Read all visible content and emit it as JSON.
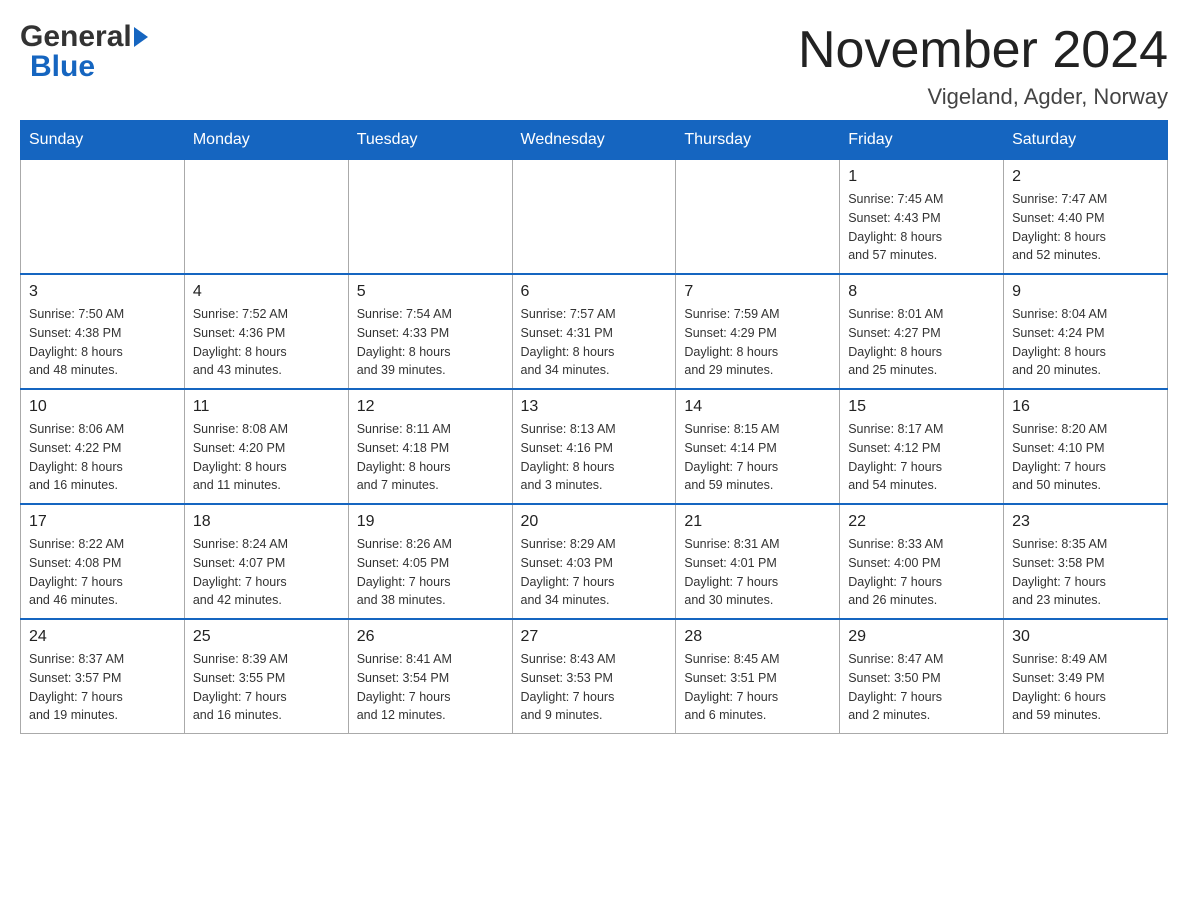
{
  "header": {
    "month_title": "November 2024",
    "location": "Vigeland, Agder, Norway"
  },
  "weekdays": [
    "Sunday",
    "Monday",
    "Tuesday",
    "Wednesday",
    "Thursday",
    "Friday",
    "Saturday"
  ],
  "weeks": [
    [
      {
        "day": "",
        "info": ""
      },
      {
        "day": "",
        "info": ""
      },
      {
        "day": "",
        "info": ""
      },
      {
        "day": "",
        "info": ""
      },
      {
        "day": "",
        "info": ""
      },
      {
        "day": "1",
        "info": "Sunrise: 7:45 AM\nSunset: 4:43 PM\nDaylight: 8 hours\nand 57 minutes."
      },
      {
        "day": "2",
        "info": "Sunrise: 7:47 AM\nSunset: 4:40 PM\nDaylight: 8 hours\nand 52 minutes."
      }
    ],
    [
      {
        "day": "3",
        "info": "Sunrise: 7:50 AM\nSunset: 4:38 PM\nDaylight: 8 hours\nand 48 minutes."
      },
      {
        "day": "4",
        "info": "Sunrise: 7:52 AM\nSunset: 4:36 PM\nDaylight: 8 hours\nand 43 minutes."
      },
      {
        "day": "5",
        "info": "Sunrise: 7:54 AM\nSunset: 4:33 PM\nDaylight: 8 hours\nand 39 minutes."
      },
      {
        "day": "6",
        "info": "Sunrise: 7:57 AM\nSunset: 4:31 PM\nDaylight: 8 hours\nand 34 minutes."
      },
      {
        "day": "7",
        "info": "Sunrise: 7:59 AM\nSunset: 4:29 PM\nDaylight: 8 hours\nand 29 minutes."
      },
      {
        "day": "8",
        "info": "Sunrise: 8:01 AM\nSunset: 4:27 PM\nDaylight: 8 hours\nand 25 minutes."
      },
      {
        "day": "9",
        "info": "Sunrise: 8:04 AM\nSunset: 4:24 PM\nDaylight: 8 hours\nand 20 minutes."
      }
    ],
    [
      {
        "day": "10",
        "info": "Sunrise: 8:06 AM\nSunset: 4:22 PM\nDaylight: 8 hours\nand 16 minutes."
      },
      {
        "day": "11",
        "info": "Sunrise: 8:08 AM\nSunset: 4:20 PM\nDaylight: 8 hours\nand 11 minutes."
      },
      {
        "day": "12",
        "info": "Sunrise: 8:11 AM\nSunset: 4:18 PM\nDaylight: 8 hours\nand 7 minutes."
      },
      {
        "day": "13",
        "info": "Sunrise: 8:13 AM\nSunset: 4:16 PM\nDaylight: 8 hours\nand 3 minutes."
      },
      {
        "day": "14",
        "info": "Sunrise: 8:15 AM\nSunset: 4:14 PM\nDaylight: 7 hours\nand 59 minutes."
      },
      {
        "day": "15",
        "info": "Sunrise: 8:17 AM\nSunset: 4:12 PM\nDaylight: 7 hours\nand 54 minutes."
      },
      {
        "day": "16",
        "info": "Sunrise: 8:20 AM\nSunset: 4:10 PM\nDaylight: 7 hours\nand 50 minutes."
      }
    ],
    [
      {
        "day": "17",
        "info": "Sunrise: 8:22 AM\nSunset: 4:08 PM\nDaylight: 7 hours\nand 46 minutes."
      },
      {
        "day": "18",
        "info": "Sunrise: 8:24 AM\nSunset: 4:07 PM\nDaylight: 7 hours\nand 42 minutes."
      },
      {
        "day": "19",
        "info": "Sunrise: 8:26 AM\nSunset: 4:05 PM\nDaylight: 7 hours\nand 38 minutes."
      },
      {
        "day": "20",
        "info": "Sunrise: 8:29 AM\nSunset: 4:03 PM\nDaylight: 7 hours\nand 34 minutes."
      },
      {
        "day": "21",
        "info": "Sunrise: 8:31 AM\nSunset: 4:01 PM\nDaylight: 7 hours\nand 30 minutes."
      },
      {
        "day": "22",
        "info": "Sunrise: 8:33 AM\nSunset: 4:00 PM\nDaylight: 7 hours\nand 26 minutes."
      },
      {
        "day": "23",
        "info": "Sunrise: 8:35 AM\nSunset: 3:58 PM\nDaylight: 7 hours\nand 23 minutes."
      }
    ],
    [
      {
        "day": "24",
        "info": "Sunrise: 8:37 AM\nSunset: 3:57 PM\nDaylight: 7 hours\nand 19 minutes."
      },
      {
        "day": "25",
        "info": "Sunrise: 8:39 AM\nSunset: 3:55 PM\nDaylight: 7 hours\nand 16 minutes."
      },
      {
        "day": "26",
        "info": "Sunrise: 8:41 AM\nSunset: 3:54 PM\nDaylight: 7 hours\nand 12 minutes."
      },
      {
        "day": "27",
        "info": "Sunrise: 8:43 AM\nSunset: 3:53 PM\nDaylight: 7 hours\nand 9 minutes."
      },
      {
        "day": "28",
        "info": "Sunrise: 8:45 AM\nSunset: 3:51 PM\nDaylight: 7 hours\nand 6 minutes."
      },
      {
        "day": "29",
        "info": "Sunrise: 8:47 AM\nSunset: 3:50 PM\nDaylight: 7 hours\nand 2 minutes."
      },
      {
        "day": "30",
        "info": "Sunrise: 8:49 AM\nSunset: 3:49 PM\nDaylight: 6 hours\nand 59 minutes."
      }
    ]
  ]
}
